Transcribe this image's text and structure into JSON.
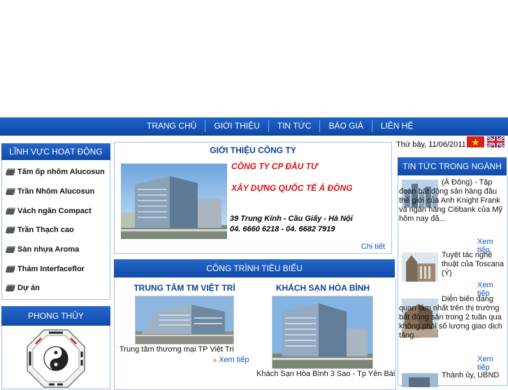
{
  "nav": {
    "items": [
      "TRANG CHỦ",
      "GIỚI THIỆU",
      "TIN TỨC",
      "BÁO GIÁ",
      "LIÊN HỆ"
    ]
  },
  "left": {
    "linh_vuc_title": "LĨNH VỰC HOẠT ĐỘNG",
    "items": [
      "Tấm ốp nhôm Alucosun",
      "Trần Nhôm Alucosun",
      "Vách ngăn Compact",
      "Trần Thạch cao",
      "Sàn nhựa Aroma",
      "Thảm Interfaceflor",
      "Dự án"
    ],
    "phong_thuy_title": "PHONG THỦY"
  },
  "intro": {
    "title": "GIỚI THIỆU CÔNG TY",
    "name_line1": "CÔNG TY CP ĐẦU TƯ",
    "name_line2": "XÂY DỰNG QUỐC TẾ Á ĐÔNG",
    "address": "39 Trung Kính - Cầu Giấy - Hà Nội",
    "phone": "04. 6660 6218 - 04. 6682 7919",
    "more": "Chi tiết"
  },
  "projects": {
    "title": "CÔNG TRÌNH TIÊU BIỂU",
    "items": [
      {
        "title": "TRUNG TÂM TM VIỆT TRÌ",
        "caption": "Trung tâm thương mại TP Việt Trì",
        "more": "Xem tiếp"
      },
      {
        "title": "KHÁCH SẠN HÒA BÌNH",
        "caption": "Khách Sạn Hòa Bình 3 Sao - Tp Yên Bái"
      }
    ]
  },
  "right": {
    "date": "Thứ bảy, 11/06/2011",
    "news_title": "TIN TỨC TRONG NGÀNH",
    "news": [
      {
        "text": "(Á Đông) - Tập đoàn bất động sản hàng đầu thế giới của Anh Knight Frank và ngân hàng Citibank của Mỹ hôm nay đã...",
        "more": "Xem tiếp"
      },
      {
        "text": "Tuyệt tác nghệ thuật của Toscana (Ý)",
        "more": "Xem tiếp"
      },
      {
        "text": "Diễn biến đáng quan tâm nhất trên thị trường bất động sản trong 2 tuần qua không phải số lượng giao dịch tăng...",
        "more": "Xem tiếp"
      },
      {
        "text": "Thành ủy, UBND"
      }
    ]
  },
  "colors": {
    "nav_blue": "#1456bb",
    "title_blue": "#0b3f99",
    "accent_red": "#e01010",
    "link_blue": "#0b55c8"
  }
}
